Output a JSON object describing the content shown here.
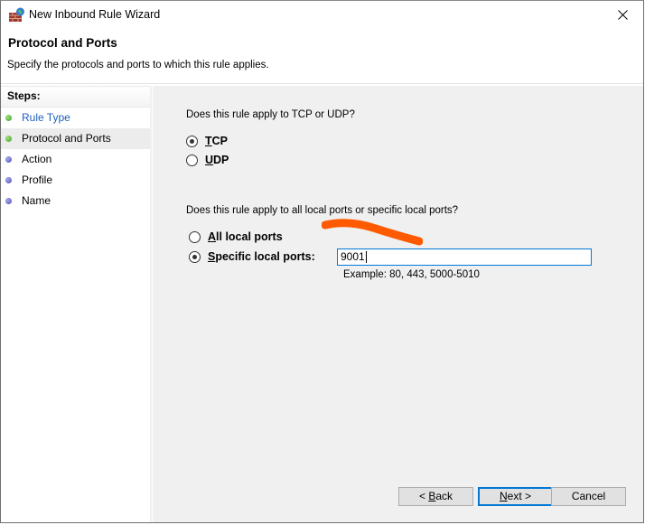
{
  "window": {
    "title": "New Inbound Rule Wizard",
    "icon": "firewall-icon",
    "close_icon": "close-icon"
  },
  "header": {
    "title": "Protocol and Ports",
    "description": "Specify the protocols and ports to which this rule applies."
  },
  "sidebar": {
    "heading": "Steps:",
    "items": [
      {
        "label": "Rule Type",
        "status": "completed",
        "dot_color": "#3aa524",
        "link": true
      },
      {
        "label": "Protocol and Ports",
        "status": "current",
        "dot_color": "#3aa524",
        "link": false
      },
      {
        "label": "Action",
        "status": "pending",
        "dot_color": "#4b4bb4",
        "link": false
      },
      {
        "label": "Profile",
        "status": "pending",
        "dot_color": "#4b4bb4",
        "link": false
      },
      {
        "label": "Name",
        "status": "pending",
        "dot_color": "#4b4bb4",
        "link": false
      }
    ]
  },
  "protocol": {
    "question": "Does this rule apply to TCP or UDP?",
    "options": [
      {
        "label": "TCP",
        "mnemonic": "T",
        "rest": "CP",
        "selected": true
      },
      {
        "label": "UDP",
        "mnemonic": "U",
        "rest": "DP",
        "selected": false
      }
    ]
  },
  "ports": {
    "question": "Does this rule apply to all local ports or specific local ports?",
    "options": [
      {
        "label": "All local ports",
        "mnemonic": "A",
        "rest": "ll local ports",
        "selected": false
      },
      {
        "label": "Specific local ports:",
        "mnemonic": "S",
        "rest": "pecific local ports:",
        "selected": true
      }
    ],
    "input_value": "9001",
    "example": "Example: 80, 443, 5000-5010"
  },
  "annotation": {
    "color": "#ff5a00"
  },
  "buttons": {
    "back": {
      "prefix": "< ",
      "mnemonic": "B",
      "rest": "ack"
    },
    "next": {
      "mnemonic": "N",
      "rest": "ext >"
    },
    "cancel": "Cancel"
  },
  "accent": "#0078d7"
}
